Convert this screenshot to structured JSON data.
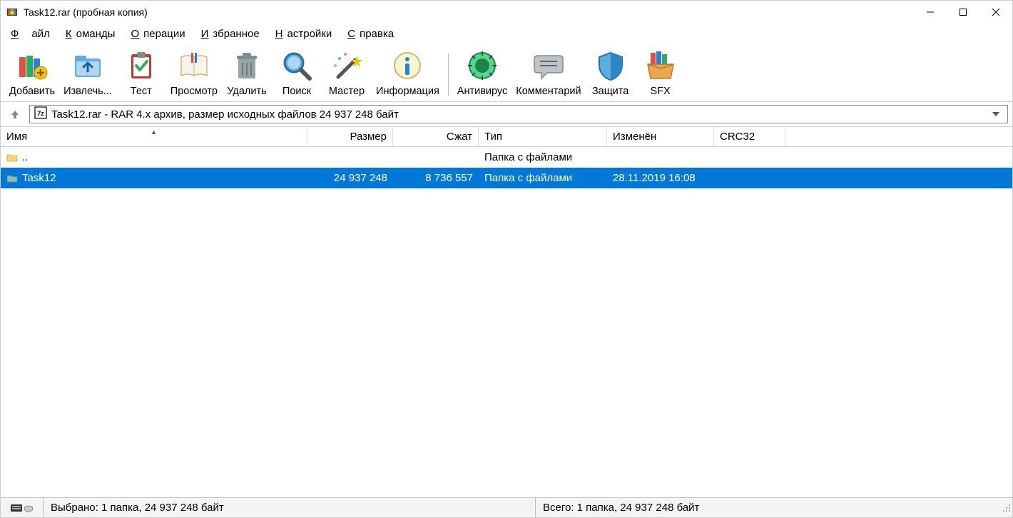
{
  "window": {
    "title": "Task12.rar (пробная копия)"
  },
  "menu": {
    "file": "Файл",
    "commands": "Команды",
    "operations": "Операции",
    "favorites": "Избранное",
    "settings": "Настройки",
    "help": "Справка"
  },
  "toolbar": {
    "add": "Добавить",
    "extract": "Извлечь...",
    "test": "Тест",
    "view": "Просмотр",
    "delete": "Удалить",
    "find": "Поиск",
    "wizard": "Мастер",
    "info": "Информация",
    "antivirus": "Антивирус",
    "comment": "Комментарий",
    "protect": "Защита",
    "sfx": "SFX"
  },
  "path": "Task12.rar - RAR 4.x архив, размер исходных файлов 24 937 248 байт",
  "columns": {
    "name": "Имя",
    "size": "Размер",
    "packed": "Сжат",
    "type": "Тип",
    "modified": "Изменён",
    "crc": "CRC32"
  },
  "rows": [
    {
      "name": "..",
      "size": "",
      "packed": "",
      "type": "Папка с файлами",
      "modified": "",
      "crc": "",
      "selected": false,
      "icon": "folder-up"
    },
    {
      "name": "Task12",
      "size": "24 937 248",
      "packed": "8 736 557",
      "type": "Папка с файлами",
      "modified": "28.11.2019 16:08",
      "crc": "",
      "selected": true,
      "icon": "folder"
    }
  ],
  "status": {
    "selected": "Выбрано: 1 папка, 24 937 248 байт",
    "total": "Всего: 1 папка, 24 937 248 байт"
  }
}
